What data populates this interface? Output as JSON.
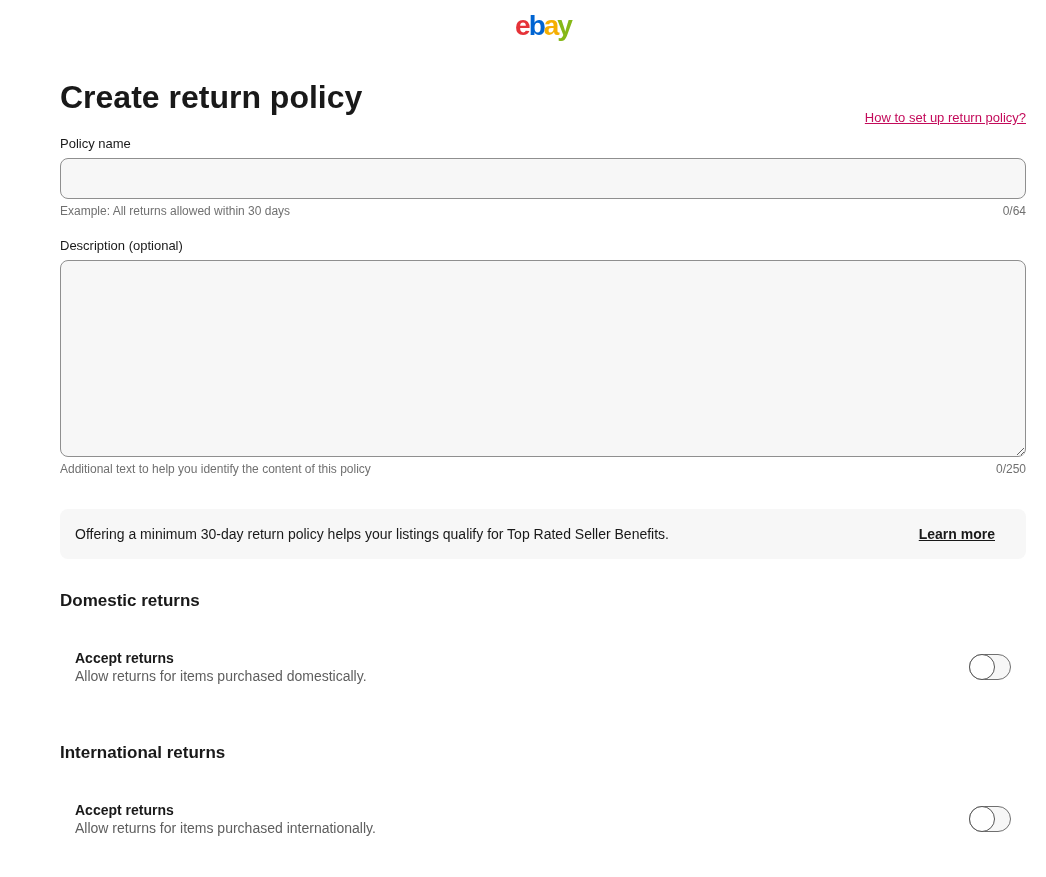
{
  "logo": {
    "letters": [
      {
        "char": "e",
        "color": "#e53238"
      },
      {
        "char": "b",
        "color": "#0064d2"
      },
      {
        "char": "a",
        "color": "#f5af02"
      },
      {
        "char": "y",
        "color": "#86b817"
      }
    ]
  },
  "title": "Create return policy",
  "help_link": "How to set up return policy?",
  "policy_name": {
    "label": "Policy name",
    "hint": "Example: All returns allowed within 30 days",
    "count": "0/64"
  },
  "description": {
    "label": "Description (optional)",
    "hint": "Additional text to help you identify the content of this policy",
    "count": "0/250"
  },
  "banner": {
    "text": "Offering a minimum 30-day return policy helps your listings qualify for Top Rated Seller Benefits.",
    "link": "Learn more"
  },
  "sections": [
    {
      "heading": "Domestic returns",
      "title": "Accept returns",
      "subtitle": "Allow returns for items purchased domestically.",
      "on": false
    },
    {
      "heading": "International returns",
      "title": "Accept returns",
      "subtitle": "Allow returns for items purchased internationally.",
      "on": false
    }
  ]
}
